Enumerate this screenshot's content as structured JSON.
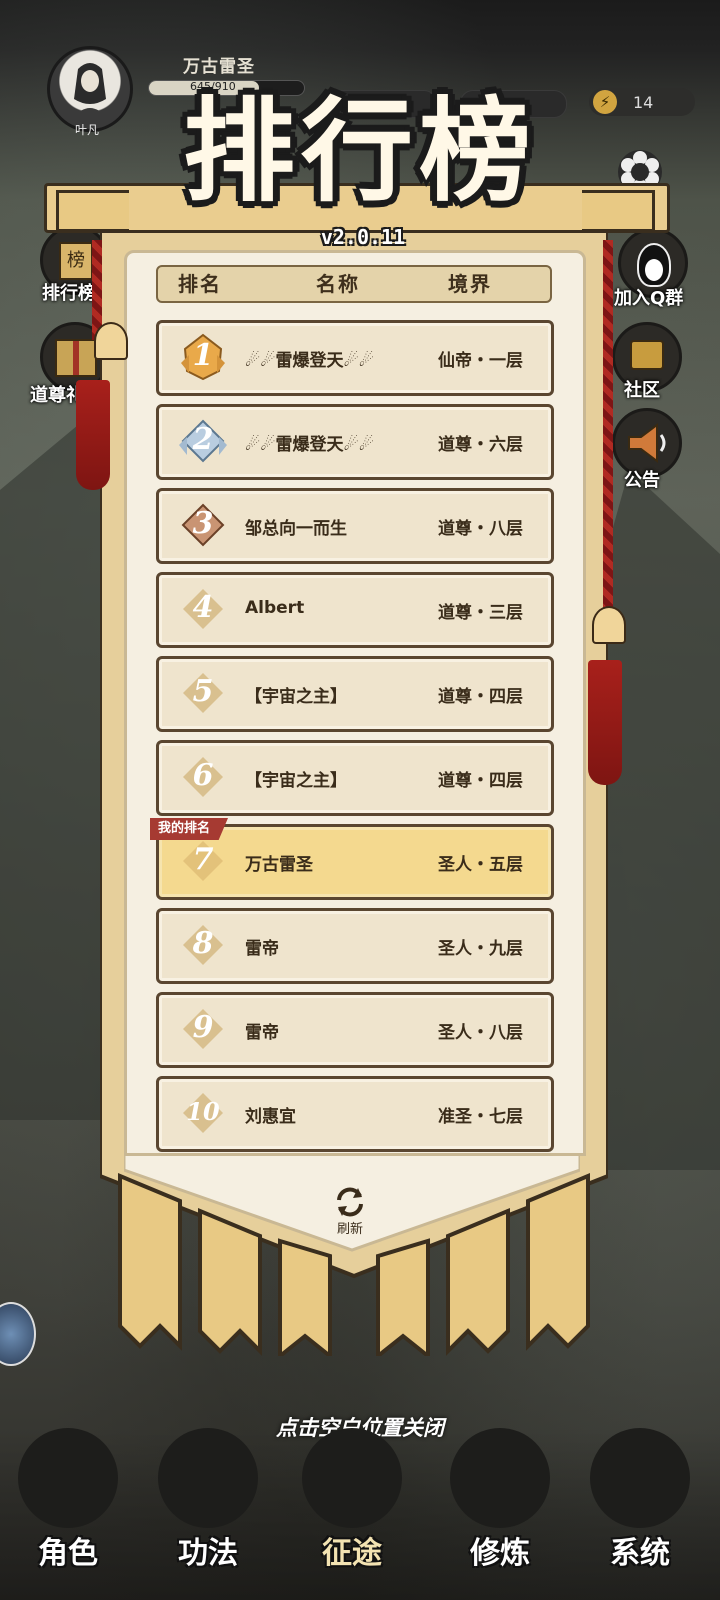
{
  "player": {
    "avatar_name": "叶凡",
    "name": "万古雷圣",
    "exp_text": "645/910",
    "exp_fraction": 0.71
  },
  "energy": {
    "value": "14"
  },
  "side_left": [
    {
      "label": "排行榜"
    },
    {
      "label": "道尊礼包"
    }
  ],
  "side_right": [
    {
      "label": "加入Q群"
    },
    {
      "label": "社区"
    },
    {
      "label": "公告"
    }
  ],
  "leaderboard": {
    "title": "排行榜",
    "version": "v2.0.11",
    "headers": {
      "rank": "排名",
      "name": "名称",
      "realm": "境界"
    },
    "my_rank_tag": "我的排名",
    "rows": [
      {
        "rank": "1",
        "name": "☄☄雷爆登天☄☄",
        "realm": "仙帝・一层"
      },
      {
        "rank": "2",
        "name": "☄☄雷爆登天☄☄",
        "realm": "道尊・六层"
      },
      {
        "rank": "3",
        "name": "邹总向一而生",
        "realm": "道尊・八层"
      },
      {
        "rank": "4",
        "name": "Albert",
        "realm": "道尊・三层"
      },
      {
        "rank": "5",
        "name": "【宇宙之主】",
        "realm": "道尊・四层"
      },
      {
        "rank": "6",
        "name": "【宇宙之主】",
        "realm": "道尊・四层"
      },
      {
        "rank": "7",
        "name": "万古雷圣",
        "realm": "圣人・五层"
      },
      {
        "rank": "8",
        "name": "雷帝",
        "realm": "圣人・九层"
      },
      {
        "rank": "9",
        "name": "雷帝",
        "realm": "圣人・八层"
      },
      {
        "rank": "10",
        "name": "刘惠宜",
        "realm": "准圣・七层"
      }
    ],
    "refresh_label": "刷新",
    "close_tip": "点击空白位置关闭"
  },
  "nav": [
    {
      "label": "角色"
    },
    {
      "label": "功法"
    },
    {
      "label": "征途"
    },
    {
      "label": "修炼"
    },
    {
      "label": "系统"
    }
  ],
  "colors": {
    "gold": "#eacd8f",
    "my_row": "#f4d98f",
    "tag_red": "#a63a32",
    "tassel_red": "#a8201b"
  }
}
